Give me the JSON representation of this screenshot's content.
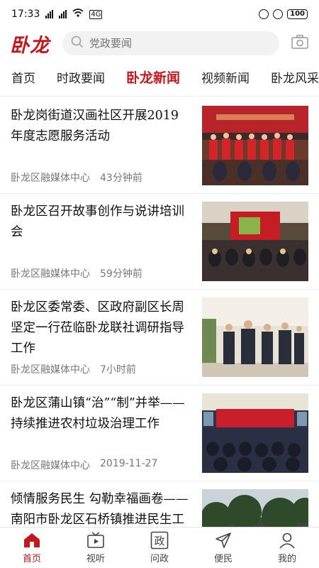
{
  "status_bar": {
    "time": "17:33",
    "network": "4G",
    "battery": "100"
  },
  "header": {
    "logo": "卧龙",
    "search_placeholder": "党政要闻"
  },
  "tabs": [
    {
      "label": "首页",
      "active": false
    },
    {
      "label": "时政要闻",
      "active": false
    },
    {
      "label": "卧龙新闻",
      "active": true
    },
    {
      "label": "视频新闻",
      "active": false
    },
    {
      "label": "卧龙风采",
      "active": false
    }
  ],
  "news": [
    {
      "title": "卧龙岗街道汉画社区开展2019年度志愿服务活动",
      "source": "卧龙区融媒体中心",
      "time": "43分钟前"
    },
    {
      "title": "卧龙区召开故事创作与说讲培训会",
      "source": "卧龙区融媒体中心",
      "time": "59分钟前"
    },
    {
      "title": "卧龙区委常委、区政府副区长周坚定一行莅临卧龙联社调研指导工作",
      "source": "卧龙区融媒体中心",
      "time": "7小时前"
    },
    {
      "title": "卧龙区蒲山镇“治”“制”并举—— 持续推进农村垃圾治理工作",
      "source": "卧龙区融媒体中心",
      "time": "2019-11-27"
    },
    {
      "title": "倾情服务民生 勾勒幸福画卷——南阳市卧龙区石桥镇推进民生工",
      "source": "",
      "time": ""
    }
  ],
  "bottom_nav": [
    {
      "label": "首页",
      "icon": "home-icon",
      "active": true
    },
    {
      "label": "视听",
      "icon": "tv-icon",
      "active": false
    },
    {
      "label": "问政",
      "icon": "zheng-icon",
      "active": false
    },
    {
      "label": "便民",
      "icon": "send-icon",
      "active": false
    },
    {
      "label": "我的",
      "icon": "user-icon",
      "active": false
    }
  ],
  "colors": {
    "accent": "#c8161d"
  }
}
